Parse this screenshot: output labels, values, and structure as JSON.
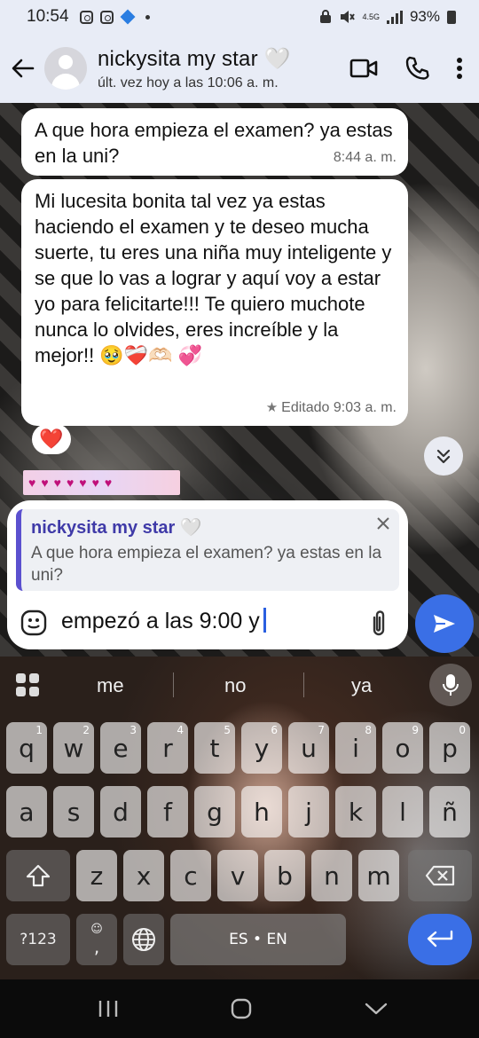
{
  "status_bar": {
    "time": "10:54",
    "network": "4.5G",
    "battery": "93%"
  },
  "contact": {
    "name": "nickysita my star 🤍",
    "status": "últ. vez hoy a las 10:06 a. m."
  },
  "messages": [
    {
      "text": "A que hora empieza el examen? ya estas en la uni?",
      "time": "8:44 a. m."
    },
    {
      "text": "Mi lucesita bonita tal vez ya estas haciendo el examen y te deseo mucha suerte, tu eres una niña muy inteligente y se que lo vas a lograr y aquí voy a estar yo para felicitarte!!! Te quiero muchote nunca lo olvides, eres increíble y la mejor!! 🥹❤️‍🩹🫶🏻 💞",
      "time": "Editado 9:03 a. m.",
      "reaction": "❤️"
    }
  ],
  "reply": {
    "name": "nickysita my star 🤍",
    "text": "A que hora empieza el examen? ya estas en la uni?"
  },
  "input": {
    "value": "empezó a las 9:00 y"
  },
  "keyboard": {
    "suggestions": [
      "me",
      "no",
      "ya"
    ],
    "row1": [
      {
        "k": "q",
        "h": "1"
      },
      {
        "k": "w",
        "h": "2"
      },
      {
        "k": "e",
        "h": "3"
      },
      {
        "k": "r",
        "h": "4"
      },
      {
        "k": "t",
        "h": "5"
      },
      {
        "k": "y",
        "h": "6"
      },
      {
        "k": "u",
        "h": "7"
      },
      {
        "k": "i",
        "h": "8"
      },
      {
        "k": "o",
        "h": "9"
      },
      {
        "k": "p",
        "h": "0"
      }
    ],
    "row2": [
      "a",
      "s",
      "d",
      "f",
      "g",
      "h",
      "j",
      "k",
      "l",
      "ñ"
    ],
    "row3": [
      "z",
      "x",
      "c",
      "v",
      "b",
      "n",
      "m"
    ],
    "symbols_label": "?123",
    "comma": ",",
    "space_label": "ES • EN"
  },
  "colors": {
    "accent": "#3a6fe6",
    "header_bg": "#e8ecf6",
    "reply_bar": "#5b50cf"
  }
}
